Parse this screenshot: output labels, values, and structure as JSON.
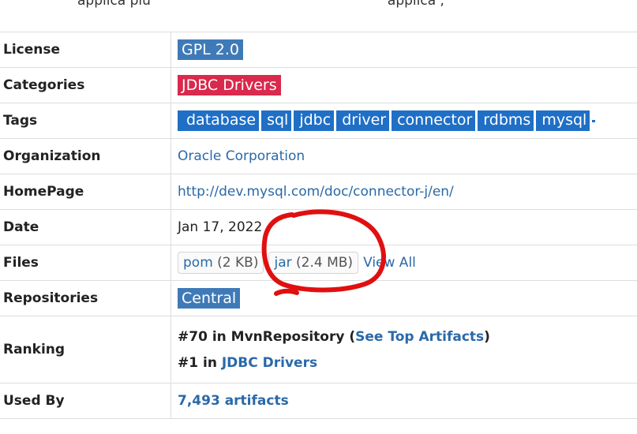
{
  "intro_fragment": {
    "left": "applica  plu",
    "right": "applica        ,"
  },
  "rows": {
    "license": {
      "label": "License",
      "value": "GPL 2.0"
    },
    "categories": {
      "label": "Categories",
      "value": "JDBC Drivers"
    },
    "tags": {
      "label": "Tags",
      "values": [
        "database",
        "sql",
        "jdbc",
        "driver",
        "connector",
        "rdbms",
        "mysql"
      ]
    },
    "organization": {
      "label": "Organization",
      "value": "Oracle Corporation"
    },
    "homepage": {
      "label": "HomePage",
      "value": "http://dev.mysql.com/doc/connector-j/en/"
    },
    "date": {
      "label": "Date",
      "value": "Jan 17, 2022"
    },
    "files": {
      "label": "Files",
      "pom_label": "pom",
      "pom_size": "(2 KB)",
      "jar_label": "jar",
      "jar_size": "(2.4 MB)",
      "view_all": "View All"
    },
    "repositories": {
      "label": "Repositories",
      "value": "Central"
    },
    "ranking": {
      "label": "Ranking",
      "line1_prefix": "#70 in MvnRepository (",
      "line1_link": "See Top Artifacts",
      "line1_suffix": ")",
      "line2_prefix": "#1 in ",
      "line2_link": "JDBC Drivers"
    },
    "used_by": {
      "label": "Used By",
      "value": "7,493 artifacts"
    }
  },
  "colors": {
    "license_badge": "#3f7ab8",
    "category_badge": "#d9294c",
    "tag_badge": "#1f6fc6",
    "link": "#2a69a8",
    "annotation": "#e01010"
  }
}
